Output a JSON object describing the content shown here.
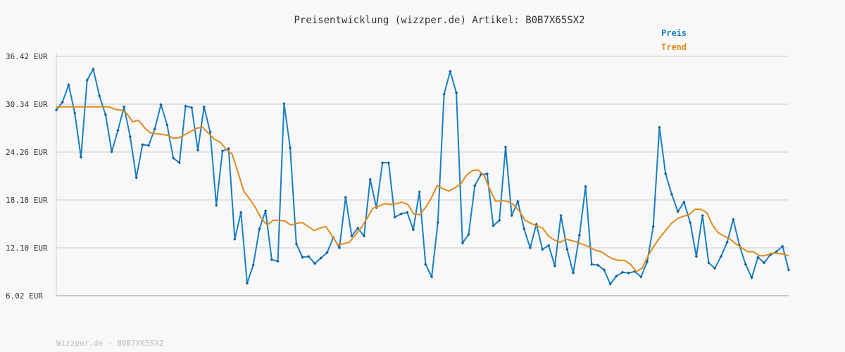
{
  "footer": "Wizzper.de - B0B7X65SX2",
  "chart_data": {
    "type": "line",
    "title": "Preisentwicklung (wizzper.de) Artikel: B0B7X65SX2",
    "xlabel": "",
    "ylabel": "",
    "ylim": [
      6.02,
      36.42
    ],
    "yticks": [
      6.02,
      12.1,
      18.18,
      24.26,
      30.34,
      36.42
    ],
    "ytick_labels": [
      "6.02 EUR",
      "12.10 EUR",
      "18.18 EUR",
      "24.26 EUR",
      "30.34 EUR",
      "36.42 EUR"
    ],
    "grid": true,
    "legend_position": "top-right",
    "series": [
      {
        "name": "Preis",
        "color": "#1a7fc4",
        "markers": true,
        "values": [
          29.6,
          30.6,
          32.8,
          29.2,
          23.6,
          33.4,
          34.8,
          31.4,
          29.0,
          24.3,
          27.0,
          30.0,
          26.2,
          21.0,
          25.2,
          25.1,
          27.2,
          30.3,
          27.7,
          23.5,
          22.9,
          30.1,
          29.9,
          24.5,
          30.0,
          26.8,
          17.5,
          24.4,
          24.7,
          13.2,
          16.6,
          7.6,
          9.9,
          14.5,
          16.8,
          10.6,
          10.4,
          30.4,
          24.8,
          12.6,
          10.9,
          11.0,
          10.1,
          10.8,
          11.5,
          13.4,
          12.1,
          18.5,
          13.6,
          14.6,
          13.6,
          20.8,
          17.2,
          22.9,
          22.9,
          16.0,
          16.4,
          16.6,
          14.4,
          19.2,
          10.0,
          8.4,
          15.3,
          31.6,
          34.5,
          31.8,
          12.7,
          13.8,
          20.0,
          21.4,
          21.5,
          14.9,
          15.6,
          24.9,
          16.2,
          18.0,
          14.5,
          12.1,
          15.1,
          11.9,
          12.4,
          9.8,
          16.2,
          11.9,
          8.9,
          13.7,
          19.9,
          10.0,
          9.9,
          9.3,
          7.5,
          8.5,
          9.0,
          8.9,
          9.1,
          8.4,
          10.3,
          14.8,
          27.4,
          21.5,
          18.9,
          16.7,
          17.9,
          15.3,
          11.0,
          16.2,
          10.2,
          9.5,
          11.0,
          12.8,
          15.7,
          12.4,
          10.0,
          8.3,
          10.9,
          10.2,
          11.2,
          11.6,
          12.3,
          9.3
        ]
      },
      {
        "name": "Trend",
        "color": "#e08a1e",
        "markers": false,
        "values": [
          30.0,
          30.0,
          30.0,
          30.0,
          30.0,
          30.0,
          30.0,
          30.0,
          30.0,
          30.0,
          29.7,
          29.6,
          29.2,
          28.1,
          28.3,
          27.4,
          26.7,
          26.6,
          26.5,
          26.4,
          26.0,
          26.1,
          26.5,
          26.9,
          27.3,
          27.4,
          26.6,
          25.9,
          25.5,
          24.6,
          24.0,
          21.7,
          19.3,
          18.3,
          17.2,
          15.8,
          15.0,
          15.6,
          15.6,
          15.5,
          15.0,
          15.2,
          15.3,
          14.8,
          14.3,
          14.6,
          14.8,
          13.7,
          12.5,
          12.6,
          12.8,
          13.7,
          14.6,
          15.8,
          17.1,
          17.4,
          17.7,
          17.6,
          17.7,
          17.9,
          17.6,
          16.4,
          16.3,
          17.2,
          18.4,
          20.0,
          19.6,
          19.3,
          19.7,
          20.2,
          21.3,
          21.9,
          22.0,
          21.3,
          19.5,
          18.0,
          18.1,
          18.0,
          17.6,
          16.8,
          15.6,
          15.2,
          14.9,
          14.6,
          13.6,
          13.1,
          12.8,
          13.2,
          13.0,
          12.8,
          12.5,
          12.2,
          11.8,
          11.6,
          11.1,
          10.7,
          10.5,
          10.5,
          10.0,
          9.1,
          9.5,
          11.1,
          12.3,
          13.4,
          14.3,
          15.2,
          15.8,
          16.1,
          16.3,
          17.0,
          17.0,
          16.6,
          15.0,
          14.0,
          13.6,
          13.2,
          12.6,
          12.1,
          11.6,
          11.6,
          11.1,
          11.1,
          11.4,
          11.4,
          11.3,
          11.1
        ]
      }
    ]
  }
}
